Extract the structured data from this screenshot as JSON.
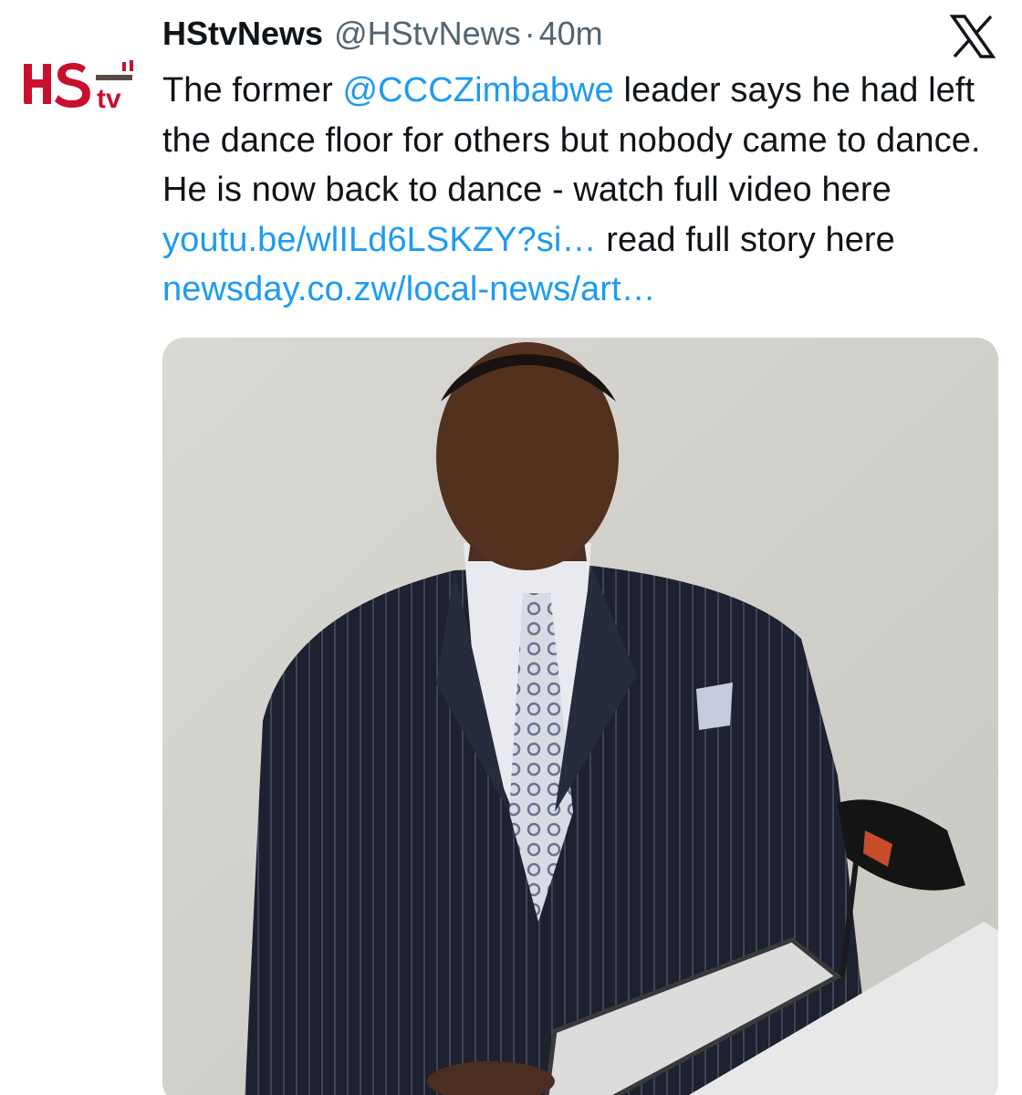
{
  "tweet": {
    "display_name": "HStvNews",
    "handle": "@HStvNews",
    "separator": "·",
    "time": "40m",
    "avatar": {
      "logo_letters": "HS",
      "logo_small": "tv",
      "brand_color": "#c8102e"
    },
    "text": {
      "part1": "The former ",
      "mention": "@CCCZimbabwe",
      "part2": " leader says he had left the dance floor for others but nobody came to dance. He is now back to dance - watch full video here ",
      "link1": "youtu.be/wlILd6LSKZY?si…",
      "part3": " read full story here ",
      "link2": "newsday.co.zw/local-news/art…"
    },
    "link_color": "#1d9bf0",
    "media": {
      "type": "video-thumbnail",
      "icon": "video-frame"
    },
    "platform_icon": "x-logo-icon"
  }
}
